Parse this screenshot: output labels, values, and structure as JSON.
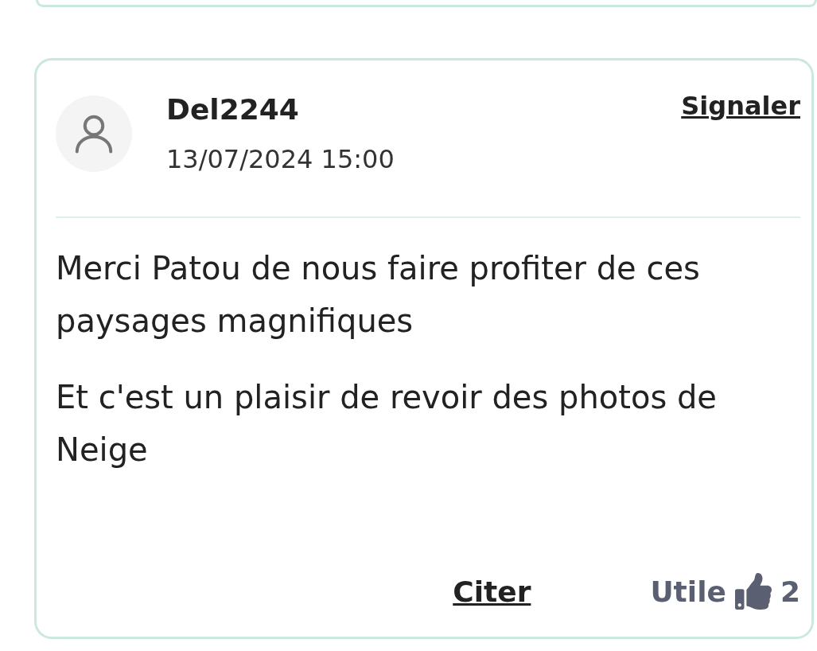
{
  "comment": {
    "author": "Del2244",
    "date": "13/07/2024 15:00",
    "report_label": "Signaler",
    "paragraphs": [
      "Merci Patou de nous faire profiter de ces paysages magnifiques",
      "Et c'est un plaisir de revoir des photos de Neige"
    ],
    "quote_label": "Citer",
    "useful_label": "Utile",
    "useful_count": "2"
  }
}
